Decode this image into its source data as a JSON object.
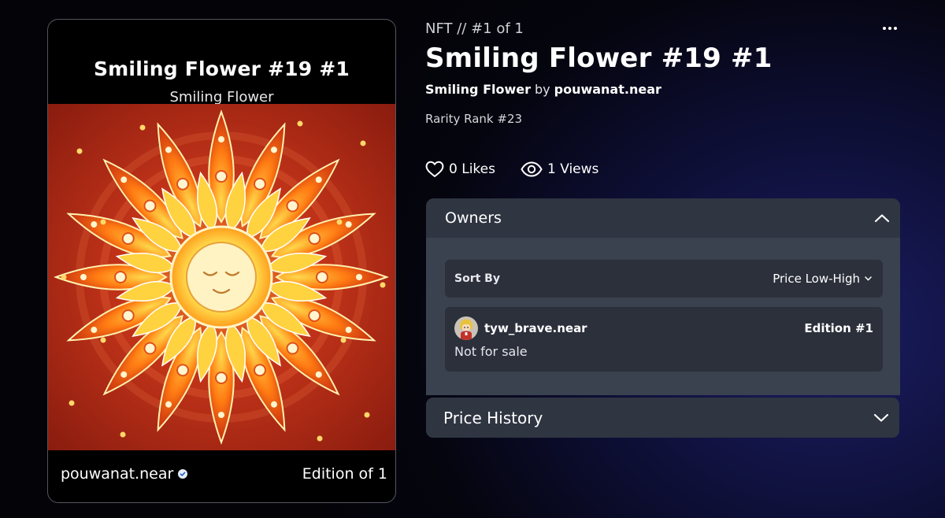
{
  "card": {
    "title": "Smiling Flower #19 #1",
    "collection": "Smiling Flower",
    "creator": "pouwanat.near",
    "edition": "Edition of 1",
    "art_colors": {
      "background": "#8a1c0f",
      "petal": "#ff7a12",
      "glow": "#ffd84a",
      "face": "#fff3c4"
    }
  },
  "header": {
    "breadcrumb": "NFT // #1 of 1",
    "more_icon": "more-horizontal-icon"
  },
  "nft": {
    "title": "Smiling Flower #19 #1",
    "collection": "Smiling Flower",
    "by": "by",
    "creator": "pouwanat.near",
    "rarity": "Rarity Rank #23",
    "likes": "0 Likes",
    "views": "1 Views"
  },
  "owners": {
    "heading": "Owners",
    "expanded": true,
    "sort_label": "Sort By",
    "sort_value": "Price Low-High",
    "rows": [
      {
        "username": "tyw_brave.near",
        "edition": "Edition #1",
        "status": "Not for sale"
      }
    ]
  },
  "price_history": {
    "heading": "Price History",
    "expanded": false
  }
}
